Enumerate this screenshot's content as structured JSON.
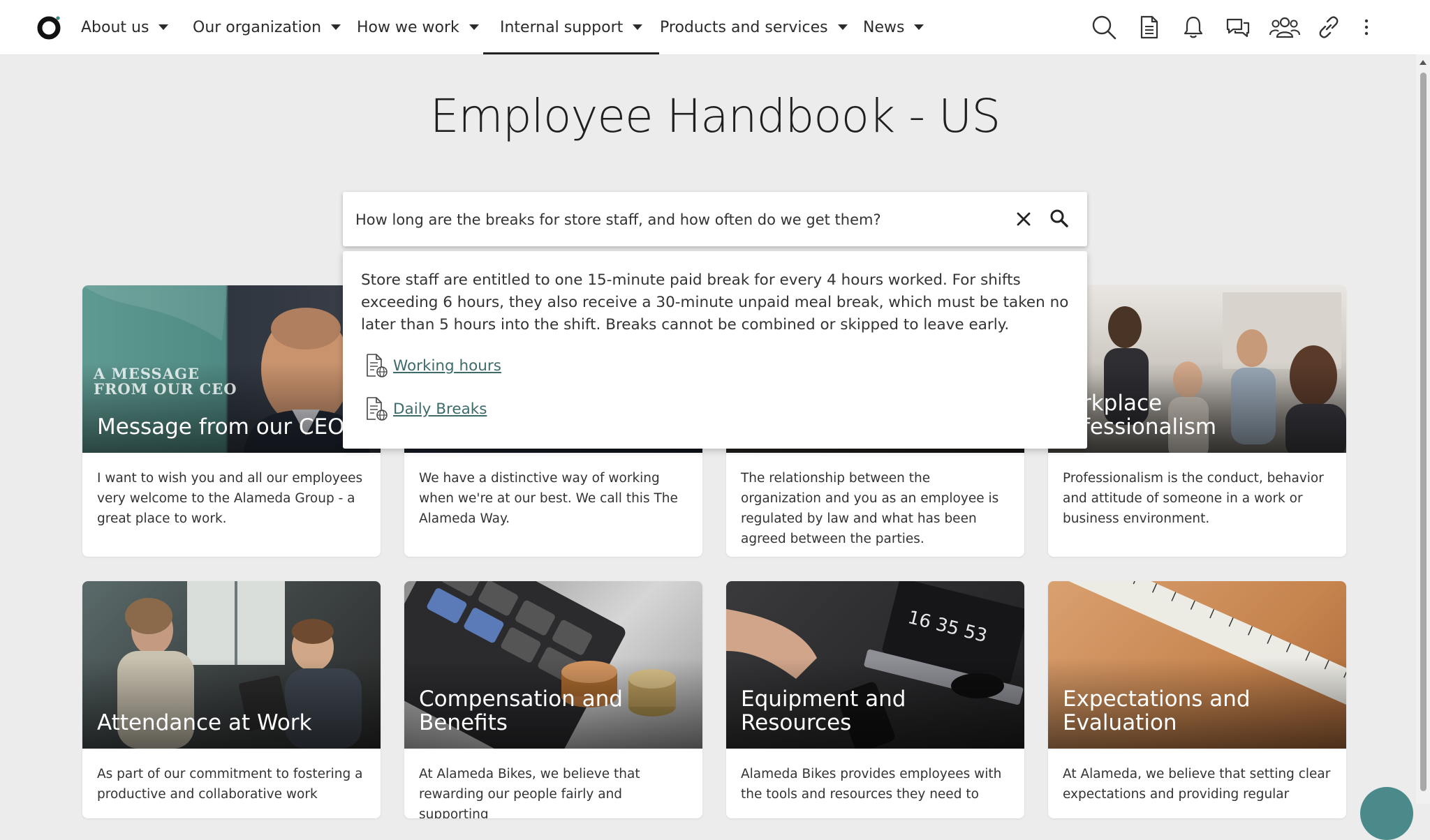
{
  "nav": {
    "items": [
      {
        "label": "About us"
      },
      {
        "label": "Our organization"
      },
      {
        "label": "How we work"
      },
      {
        "label": "Internal support"
      },
      {
        "label": "Products and services"
      },
      {
        "label": "News"
      }
    ],
    "active_item": "Internal support",
    "icons": [
      "search-icon",
      "document-icon",
      "bell-icon",
      "chat-icon",
      "people-icon",
      "link-icon",
      "more-vertical-icon"
    ]
  },
  "page": {
    "title": "Employee Handbook - US"
  },
  "search": {
    "value": "How long are the breaks for store staff, and how often do we get them?",
    "answer": "Store staff are entitled to one 15-minute paid break for every 4 hours worked. For shifts exceeding 6 hours, they also receive a 30-minute unpaid meal break, which must be taken no later than 5 hours into the shift. Breaks cannot be combined or skipped to leave early.",
    "sources": [
      {
        "label": "Working hours"
      },
      {
        "label": "Daily Breaks"
      }
    ]
  },
  "cards": [
    {
      "title": "Message from our CEO",
      "overlay": "A MESSAGE\nFROM OUR CEO",
      "text": "I want to wish you and all our employees very welcome to the Alameda Group - a great place to work."
    },
    {
      "title": "",
      "text": "We have a distinctive way of working when we're at our best. We call this The Alameda Way."
    },
    {
      "title": "",
      "text": "The relationship between the organization and you as an employee is regulated by law and what has been agreed between the parties."
    },
    {
      "title": "orkplace\nofessionalism",
      "text": "Professionalism is the conduct, behavior and attitude of someone in a work or business environment."
    },
    {
      "title": "Attendance at Work",
      "text": "As part of our commitment to fostering a productive and collaborative work"
    },
    {
      "title": "Compensation and Benefits",
      "text": "At Alameda Bikes, we believe that rewarding our people fairly and supporting"
    },
    {
      "title": "Equipment and Resources",
      "text": "Alameda Bikes provides employees with the tools and resources they need to"
    },
    {
      "title": "Expectations and Evaluation",
      "text": "At Alameda, we believe that setting clear expectations and providing regular"
    }
  ],
  "colors": {
    "link": "#3d6b6b",
    "page_bg": "#ececec",
    "chat_button": "#4a8a8a"
  }
}
